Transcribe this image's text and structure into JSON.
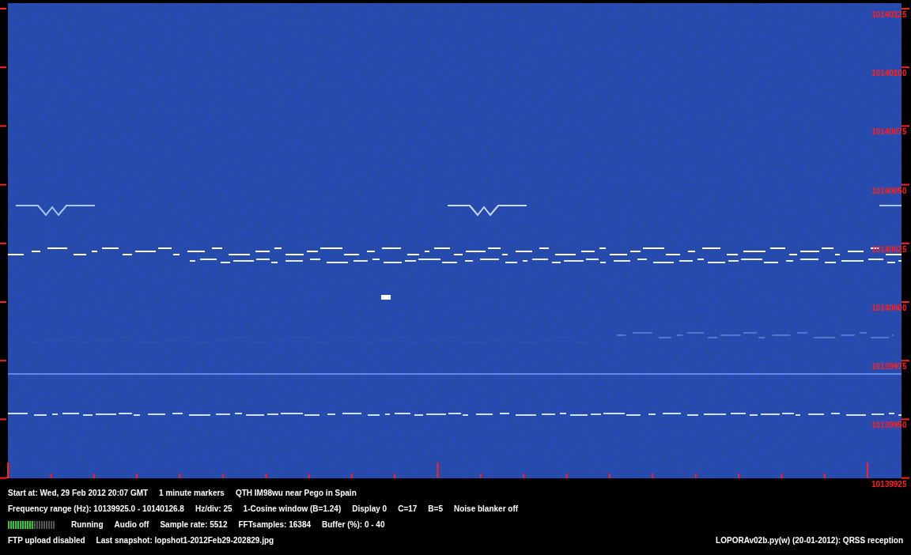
{
  "frequency_labels": [
    "10140125",
    "10140100",
    "10140075",
    "10140050",
    "10140025",
    "10140000",
    "10139975",
    "10139950",
    "10139925"
  ],
  "status_lines": [
    {
      "items": [
        "Start at: Wed, 29 Feb 2012 20:07 GMT",
        "1 minute markers",
        "QTH IM98wu near Pego in Spain"
      ]
    },
    {
      "items": [
        "Frequency range (Hz): 10139925.0 - 10140126.8",
        "Hz/div: 25",
        "1-Cosine window (B=1.24)",
        "Display 0",
        "C=17",
        "B=5",
        "Noise blanker off"
      ]
    },
    {
      "level_meter": {
        "level": 0.55
      },
      "items": [
        "Running",
        "Audio off",
        "Sample rate: 5512",
        "FFTsamples: 16384",
        "Buffer (%): 0 - 40"
      ]
    },
    {
      "items": [
        "FTP upload disabled",
        "Last snapshot: lopshot1-2012Feb29-202829.jpg"
      ],
      "right_text": "LOPORAv02b.py(w) (20-01-2012): QRSS reception"
    }
  ]
}
